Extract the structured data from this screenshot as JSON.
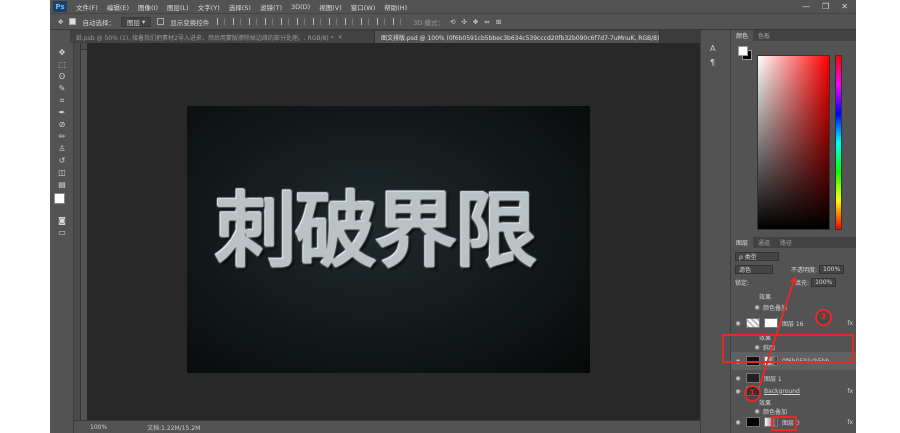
{
  "menubar": {
    "logo": "Ps",
    "items": [
      "文件(F)",
      "编辑(E)",
      "图像(I)",
      "图层(L)",
      "文字(Y)",
      "选择(S)",
      "滤镜(T)",
      "3D(D)",
      "视图(V)",
      "窗口(W)",
      "帮助(H)"
    ],
    "win_min": "—",
    "win_max": "❐",
    "win_close": "✕"
  },
  "options": {
    "auto_select_label": "自动选择：",
    "auto_select_value": "图层",
    "show_transform_label": "显示变换控件",
    "mode_3d": "3D 模式："
  },
  "tabs": [
    {
      "label": "纸.psb @ 50% (1), 接着我们把素材2导入进来，然后用蒙版擦除掉边缘的部分处理。, RGB/8) *",
      "close": "×"
    },
    {
      "label": "图文排版.psd @ 100% (0f6b0591cb5bbec3b634c539cccd20fb32b090c6f7d7-7uMnuK, RGB/8) *",
      "close": "×"
    }
  ],
  "canvas": {
    "title_text": "刺破界限"
  },
  "status": {
    "zoom": "100%",
    "doc_info": "文档:1.22M/15.2M"
  },
  "panels": {
    "color_tabs": [
      "颜色",
      "色板"
    ],
    "layer_tabs": [
      "图层",
      "通道",
      "路径"
    ],
    "filter_label": "ρ 类型",
    "blend_mode": "滤色",
    "opacity_label": "不透明度:",
    "opacity_value": "100%",
    "lock_label": "锁定:",
    "fill_label": "填充:",
    "fill_value": "100%",
    "layers": [
      {
        "name": "效果",
        "fx": false
      },
      {
        "name": "颜色叠加",
        "fx": false
      },
      {
        "name": "图层 16",
        "fx": true
      },
      {
        "name": "效果",
        "fx": false
      },
      {
        "name": "斜面",
        "fx": false
      },
      {
        "name": "0f6b0591cb5bb...",
        "fx": false
      },
      {
        "name": "图层 1",
        "fx": false
      },
      {
        "name": "Background",
        "fx": true
      },
      {
        "name": "效果",
        "fx": false
      },
      {
        "name": "颜色叠加",
        "fx": false
      },
      {
        "name": "图层 0",
        "fx": true
      }
    ]
  },
  "annotations": {
    "badge1": "①",
    "badge2": "②"
  },
  "colors": {
    "app_bg": "#535353",
    "canvas_bg": "#282828",
    "highlight": "#e52a2a"
  }
}
